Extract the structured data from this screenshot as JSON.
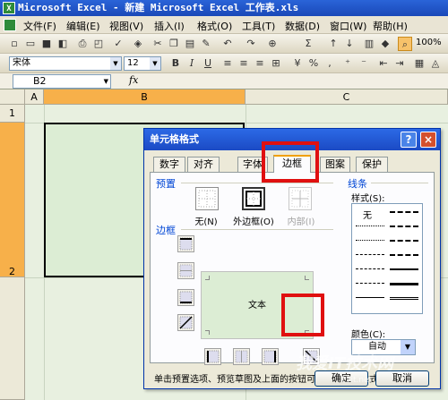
{
  "window": {
    "title": "Microsoft Excel - 新建 Microsoft Excel 工作表.xls"
  },
  "menu": [
    "文件(F)",
    "编辑(E)",
    "视图(V)",
    "插入(I)",
    "格式(O)",
    "工具(T)",
    "数据(D)",
    "窗口(W)",
    "帮助(H)"
  ],
  "toolbar": {
    "font_name": "宋体",
    "font_size": "12",
    "zoom": "100%"
  },
  "formula_bar": {
    "name_box": "B2",
    "fx": "fx"
  },
  "sheet": {
    "columns": [
      "A",
      "B",
      "C"
    ],
    "rows": [
      "1",
      "2"
    ]
  },
  "dialog": {
    "title": "单元格格式",
    "help": "?",
    "close": "×",
    "tabs": [
      "数字",
      "对齐",
      "字体",
      "边框",
      "图案",
      "保护"
    ],
    "active_tab": "边框",
    "presets_label": "预置",
    "presets": [
      "无(N)",
      "外边框(O)",
      "内部(I)"
    ],
    "border_label": "边框",
    "preview_text": "文本",
    "line_label": "线条",
    "style_label": "样式(S):",
    "style_none": "无",
    "color_label": "颜色(C):",
    "color_value": "自动",
    "instructions": "单击预置选项、预览草图及上面的按钮可以添加边框样式。",
    "ok": "确定",
    "cancel": "取消"
  },
  "watermark": {
    "main": "我爱IT技术网",
    "sub": "25it.net"
  }
}
